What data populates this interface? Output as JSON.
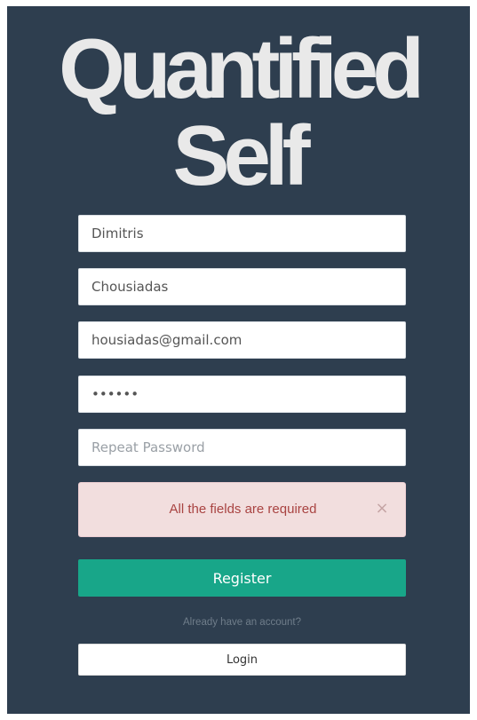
{
  "logo": {
    "line1": "Quantified",
    "line2": "Self"
  },
  "form": {
    "first_name": {
      "value": "Dimitris"
    },
    "last_name": {
      "value": "Chousiadas"
    },
    "email": {
      "value": "housiadas@gmail.com"
    },
    "password": {
      "value": "abcdef"
    },
    "repeat_password": {
      "value": "",
      "placeholder": "Repeat Password"
    }
  },
  "alert": {
    "message": "All the fields are required",
    "close_label": "×"
  },
  "buttons": {
    "register": "Register",
    "login": "Login"
  },
  "hint": "Already have an account?",
  "colors": {
    "panel_bg": "#2e3e4f",
    "register_bg": "#18a689",
    "alert_bg": "#f2dede",
    "alert_text": "#a94442"
  }
}
